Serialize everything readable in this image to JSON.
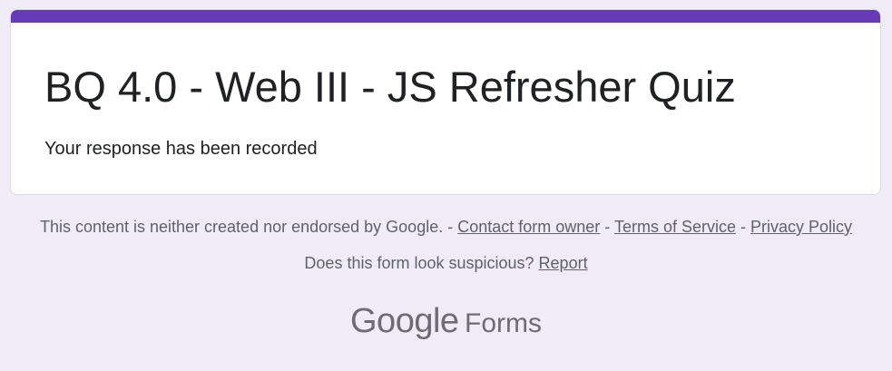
{
  "form": {
    "title": "BQ 4.0 - Web III - JS Refresher Quiz",
    "confirmation_message": "Your response has been recorded"
  },
  "footer": {
    "disclaimer_text": "This content is neither created nor endorsed by Google.",
    "separator": " - ",
    "links": {
      "contact_owner": "Contact form owner",
      "terms": "Terms of Service",
      "privacy": "Privacy Policy"
    },
    "suspicious_question": "Does this form look suspicious?",
    "report_link": "Report"
  },
  "branding": {
    "logo_word": "Google",
    "product": "Forms"
  },
  "colors": {
    "accent": "#673ab7",
    "page_background": "#efebf7",
    "card_background": "#ffffff",
    "footer_text": "#5f6368"
  }
}
